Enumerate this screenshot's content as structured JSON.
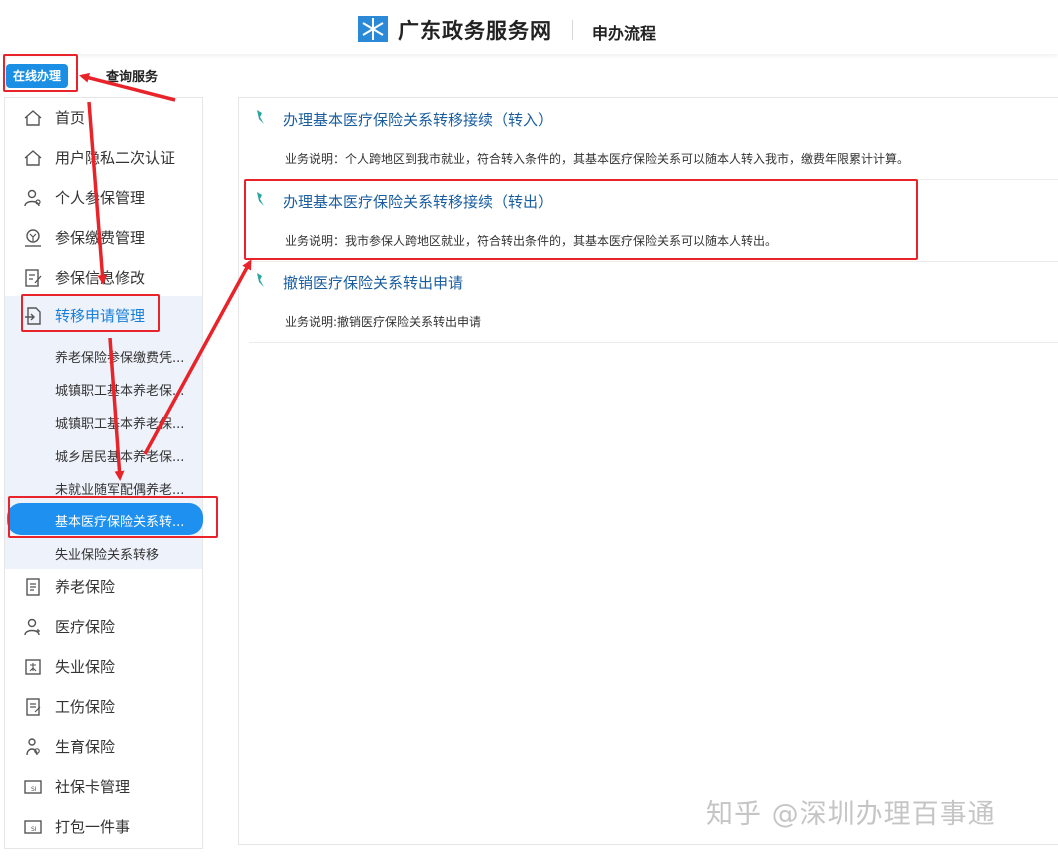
{
  "header": {
    "logo_icon": "snowflake-logo-icon",
    "site_title": "广东政务服务网",
    "subtitle": "申办流程"
  },
  "top_tabs": {
    "online": "在线办理",
    "query": "查询服务"
  },
  "sidebar": {
    "items": [
      {
        "label": "首页",
        "icon": "home-icon"
      },
      {
        "label": "用户隐私二次认证",
        "icon": "home-icon"
      },
      {
        "label": "个人参保管理",
        "icon": "user-settings-icon"
      },
      {
        "label": "参保缴费管理",
        "icon": "payment-icon"
      },
      {
        "label": "参保信息修改",
        "icon": "edit-doc-icon"
      },
      {
        "label": "转移申请管理",
        "icon": "transfer-doc-icon"
      }
    ],
    "sub_items": [
      {
        "label": "养老保险参保缴费凭..."
      },
      {
        "label": "城镇职工基本养老保..."
      },
      {
        "label": "城镇职工基本养老保..."
      },
      {
        "label": "城乡居民基本养老保..."
      },
      {
        "label": "未就业随军配偶养老..."
      },
      {
        "label": "基本医疗保险关系转..."
      },
      {
        "label": "失业保险关系转移"
      }
    ],
    "items_after": [
      {
        "label": "养老保险",
        "icon": "doc-icon"
      },
      {
        "label": "医疗保险",
        "icon": "medical-user-icon"
      },
      {
        "label": "失业保险",
        "icon": "unemployment-icon"
      },
      {
        "label": "工伤保险",
        "icon": "injury-doc-icon"
      },
      {
        "label": "生育保险",
        "icon": "maternity-icon"
      },
      {
        "label": "社保卡管理",
        "icon": "si-card-icon"
      },
      {
        "label": "打包一件事",
        "icon": "si-card-icon"
      }
    ]
  },
  "services": [
    {
      "title": "办理基本医疗保险关系转移接续（转入）",
      "desc": "业务说明：个人跨地区到我市就业，符合转入条件的，其基本医疗保险关系可以随本人转入我市，缴费年限累计计算。"
    },
    {
      "title": "办理基本医疗保险关系转移接续（转出）",
      "desc": "业务说明：我市参保人跨地区就业，符合转出条件的，其基本医疗保险关系可以随本人转出。"
    },
    {
      "title": "撤销医疗保险关系转出申请",
      "desc": "业务说明:撤销医疗保险关系转出申请"
    }
  ],
  "watermark": "知乎 @深圳办理百事通",
  "colors": {
    "accent": "#1a8fe3",
    "active_sub": "#1e90f0",
    "annotation_red": "#e8242a",
    "title_blue": "#1a5ea0"
  }
}
